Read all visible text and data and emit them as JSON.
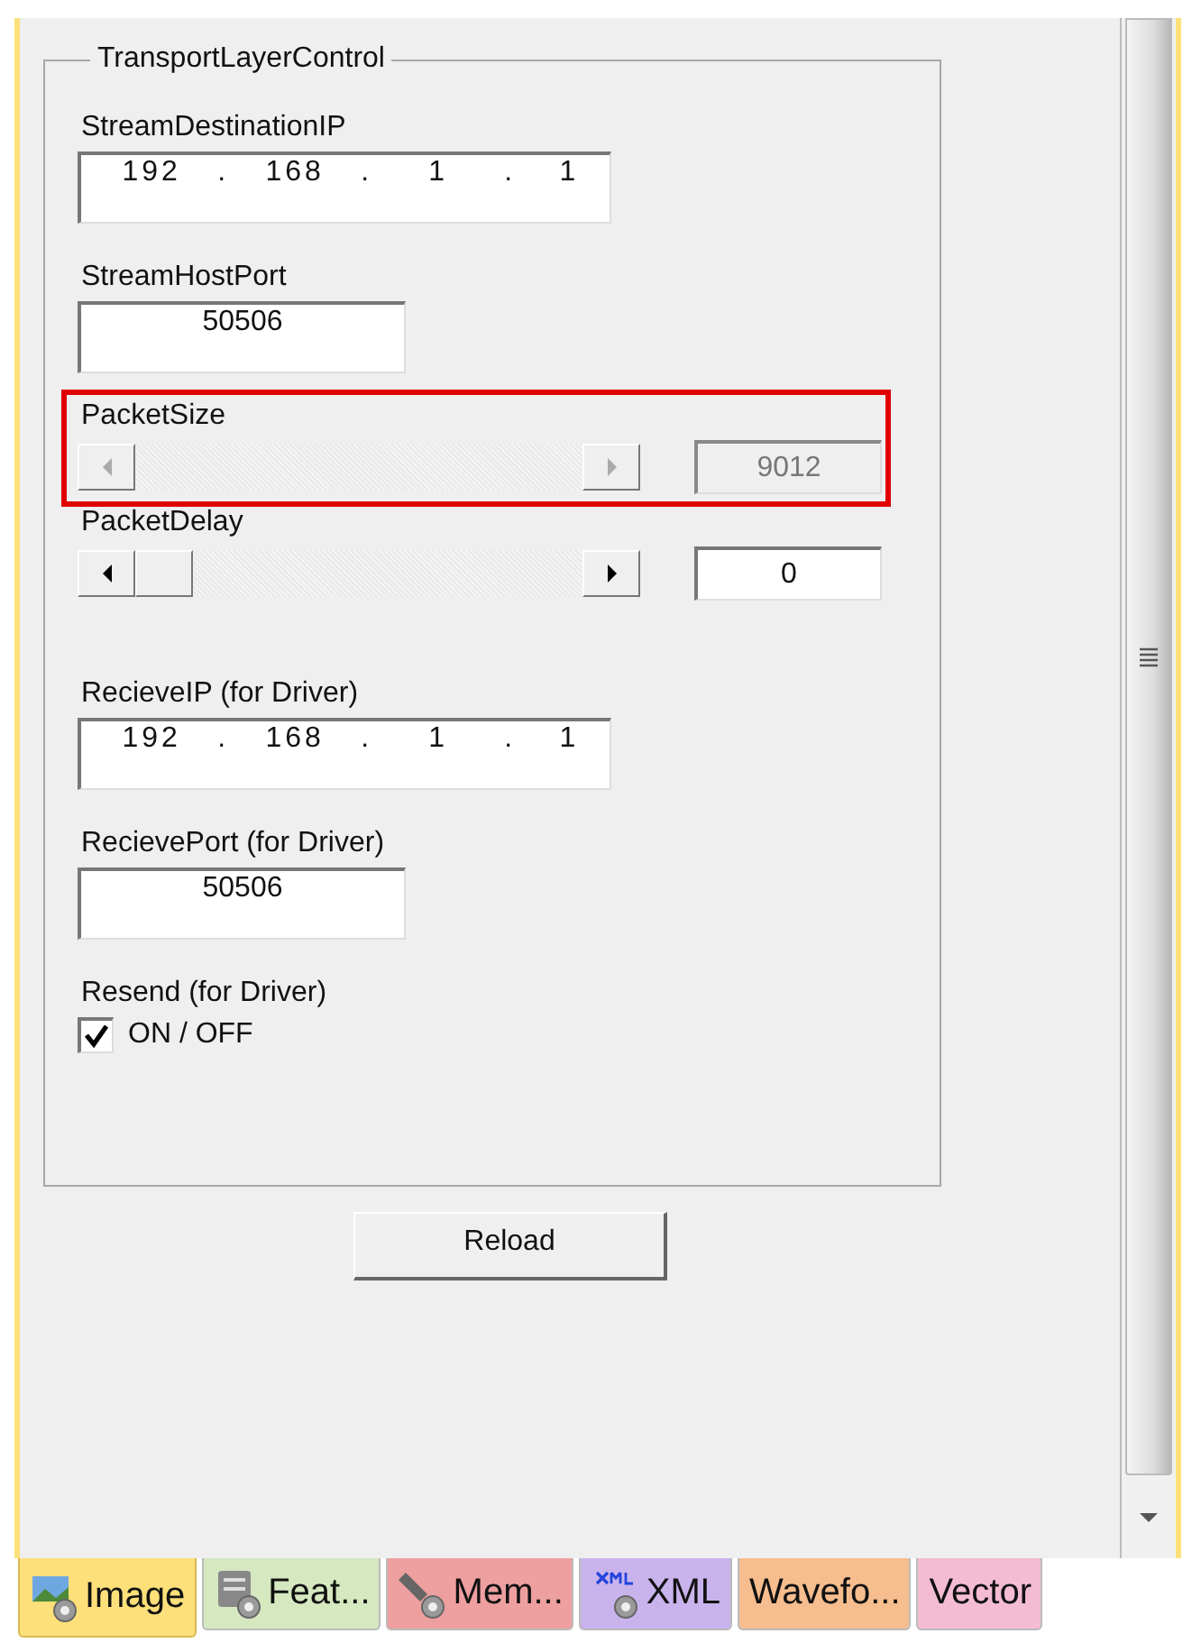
{
  "group": {
    "title": "TransportLayerControl"
  },
  "settings": [
    {
      "kind": "ip",
      "label": "StreamDestinationIP",
      "segments": [
        "192",
        ".",
        "168",
        ".",
        "1",
        ".",
        "1"
      ]
    },
    {
      "kind": "port",
      "label": "StreamHostPort",
      "value": "50506"
    },
    {
      "kind": "slider",
      "label": "PacketSize",
      "disabled": true,
      "highlighted": true,
      "value": "9012"
    },
    {
      "kind": "slider",
      "label": "PacketDelay",
      "disabled": false,
      "highlighted": false,
      "value": "0"
    },
    {
      "kind": "ip",
      "label": "RecieveIP (for Driver)",
      "segments": [
        "192",
        ".",
        "168",
        ".",
        "1",
        ".",
        "1"
      ]
    },
    {
      "kind": "port",
      "label": "RecievePort (for Driver)",
      "value": "50506"
    },
    {
      "kind": "check",
      "label": "Resend (for Driver)",
      "text": "ON / OFF",
      "checked": true
    }
  ],
  "reload_button": "Reload",
  "tabs": [
    {
      "label": "Image",
      "color": "#fde07a",
      "selected": true
    },
    {
      "label": "Feat...",
      "color": "#d5e8c0",
      "selected": false
    },
    {
      "label": "Mem...",
      "color": "#ee9fa0",
      "selected": false
    },
    {
      "label": "XML",
      "color": "#c9b3ec",
      "selected": false
    },
    {
      "label": "Wavefo...",
      "color": "#f6bd8e",
      "selected": false
    },
    {
      "label": "Vector",
      "color": "#f3bcd2",
      "selected": false
    }
  ]
}
